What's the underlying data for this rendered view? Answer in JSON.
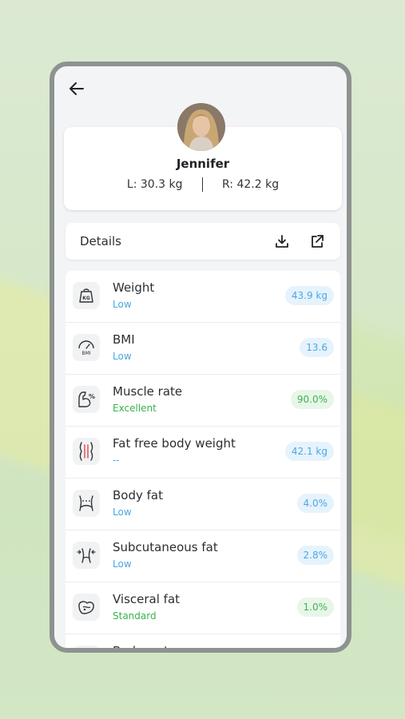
{
  "profile": {
    "name": "Jennifer",
    "left_weight": "L: 30.3 kg",
    "right_weight": "R: 42.2 kg"
  },
  "details": {
    "label": "Details"
  },
  "metrics": [
    {
      "name": "Weight",
      "status": "Low",
      "value": "43.9 kg",
      "status_color": "blue",
      "icon": "scale-kg-icon"
    },
    {
      "name": "BMI",
      "status": "Low",
      "value": "13.6",
      "status_color": "blue",
      "icon": "bmi-gauge-icon"
    },
    {
      "name": "Muscle rate",
      "status": "Excellent",
      "value": "90.0%",
      "status_color": "green",
      "icon": "muscle-arm-icon"
    },
    {
      "name": "Fat free body weight",
      "status": "--",
      "value": "42.1 kg",
      "status_color": "blue",
      "icon": "body-outline-icon"
    },
    {
      "name": "Body fat",
      "status": "Low",
      "value": "4.0%",
      "status_color": "blue",
      "icon": "waist-icon"
    },
    {
      "name": "Subcutaneous fat",
      "status": "Low",
      "value": "2.8%",
      "status_color": "blue",
      "icon": "subcutaneous-fat-icon"
    },
    {
      "name": "Visceral fat",
      "status": "Standard",
      "value": "1.0%",
      "status_color": "green",
      "icon": "organ-icon"
    },
    {
      "name": "Body water",
      "status": "",
      "value": "",
      "status_color": "green",
      "icon": "water-drop-icon"
    }
  ],
  "colors": {
    "blue_status": "#4aa7e6",
    "green_status": "#38b24a",
    "frame": "#8e9290"
  }
}
